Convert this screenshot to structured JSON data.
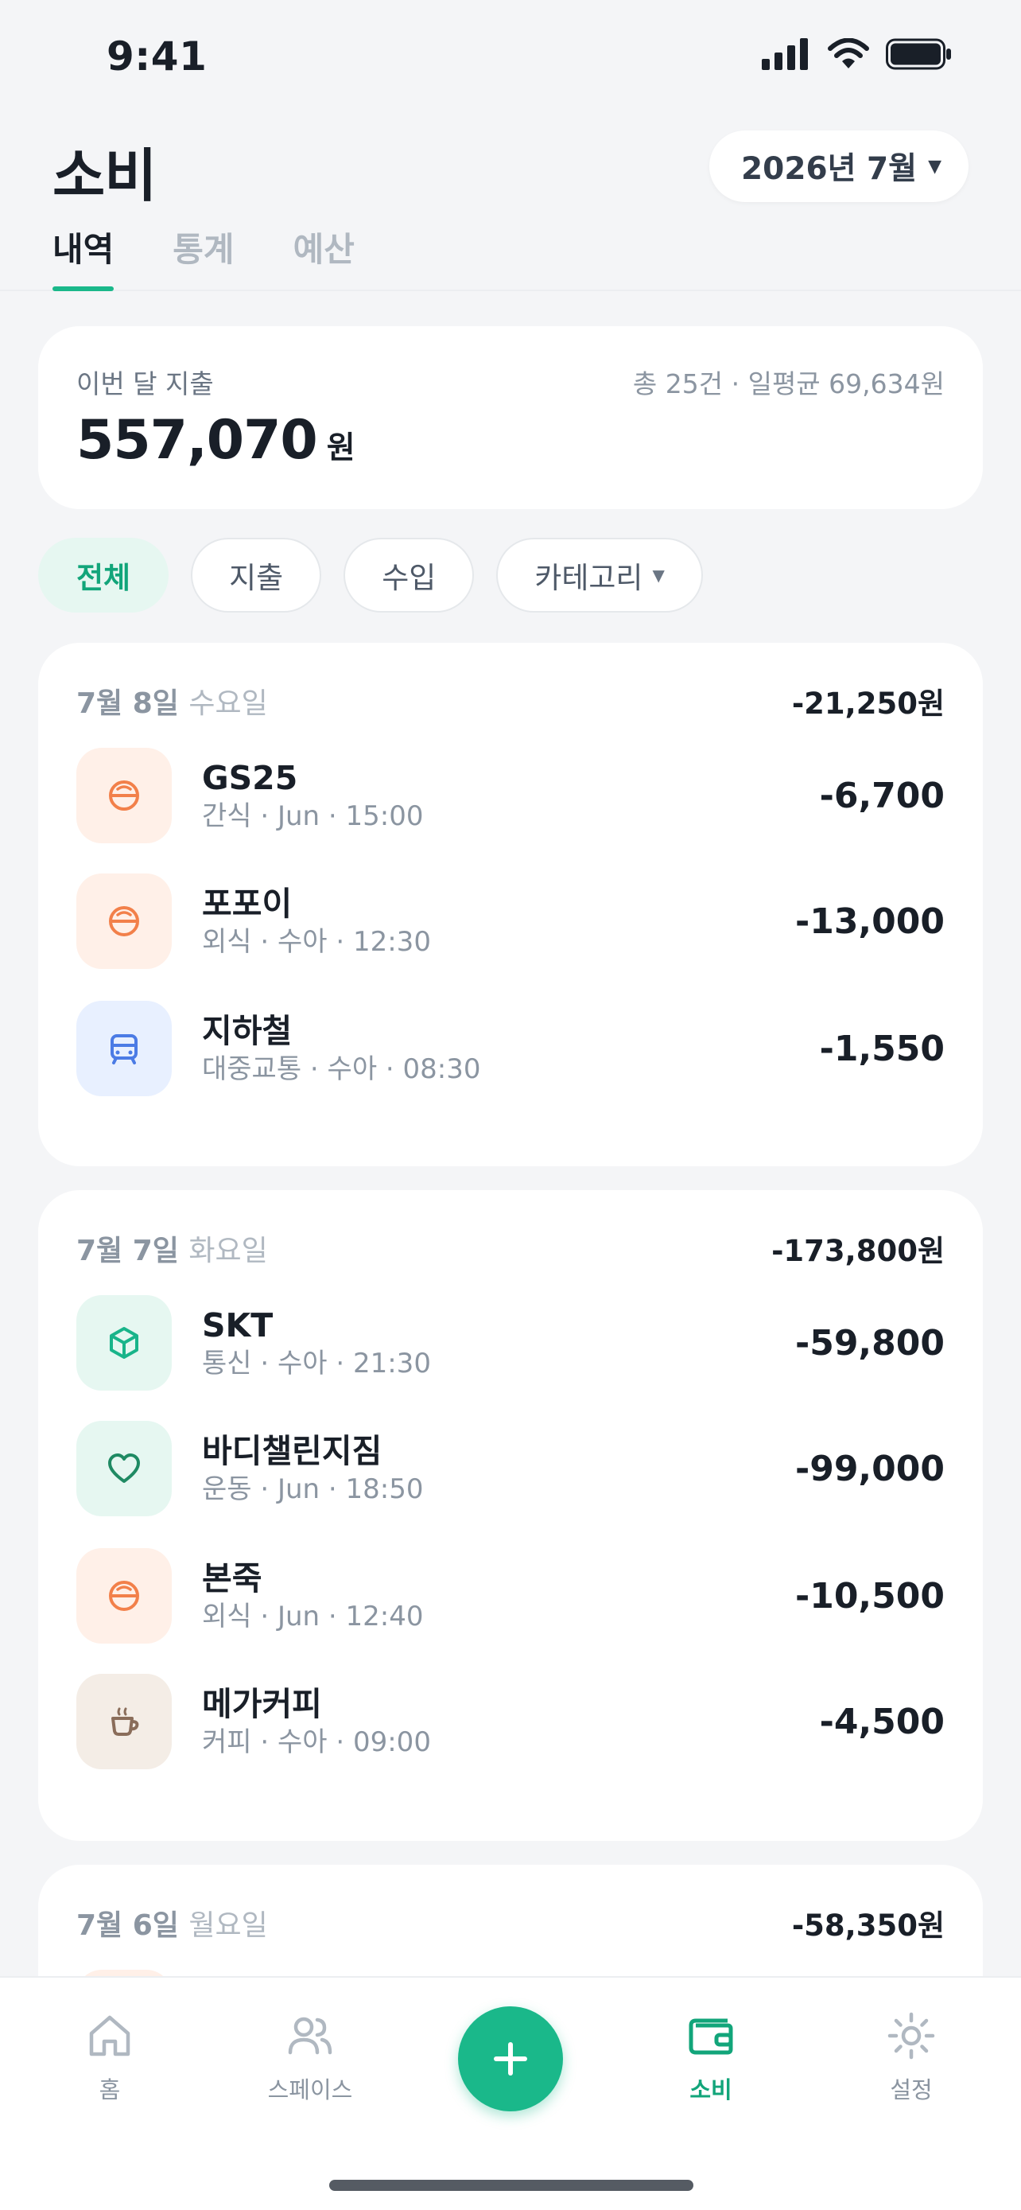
{
  "status": {
    "time": "9:41"
  },
  "header": {
    "title": "소비",
    "month": "2026년 7월",
    "tabs": [
      "내역",
      "통계",
      "예산"
    ]
  },
  "summary": {
    "label": "이번 달 지출",
    "meta": "총 25건 · 일평균 69,634원",
    "amount": "557,070",
    "unit": "원"
  },
  "filters": [
    "전체",
    "지출",
    "수입",
    "카테고리"
  ],
  "days": [
    {
      "date": "7월 8일",
      "dow": "수요일",
      "total": "-21,250원",
      "items": [
        {
          "name": "GS25",
          "sub": "간식 · Jun · 15:00",
          "amount": "-6,700",
          "icon": "food-icon"
        },
        {
          "name": "포포이",
          "sub": "외식 · 수아 · 12:30",
          "amount": "-13,000",
          "icon": "food-icon"
        },
        {
          "name": "지하철",
          "sub": "대중교통 · 수아 · 08:30",
          "amount": "-1,550",
          "icon": "subway-icon"
        }
      ]
    },
    {
      "date": "7월 7일",
      "dow": "화요일",
      "total": "-173,800원",
      "items": [
        {
          "name": "SKT",
          "sub": "통신 · 수아 · 21:30",
          "amount": "-59,800",
          "icon": "box-icon"
        },
        {
          "name": "바디챌린지짐",
          "sub": "운동 · Jun · 18:50",
          "amount": "-99,000",
          "icon": "heart-icon"
        },
        {
          "name": "본죽",
          "sub": "외식 · Jun · 12:40",
          "amount": "-10,500",
          "icon": "food-icon"
        },
        {
          "name": "메가커피",
          "sub": "커피 · 수아 · 09:00",
          "amount": "-4,500",
          "icon": "coffee-icon"
        }
      ]
    },
    {
      "date": "7월 6일",
      "dow": "월요일",
      "total": "-58,350원"
    }
  ],
  "nav": {
    "home": "홈",
    "spaces": "스페이스",
    "spending": "소비",
    "settings": "설정"
  },
  "colors": {
    "accent": "#1ab88a",
    "food": "#f2804a",
    "transit": "#4b7be5",
    "telecom": "#19b48a",
    "health": "#1f8a63",
    "coffee": "#8a6d5a"
  }
}
